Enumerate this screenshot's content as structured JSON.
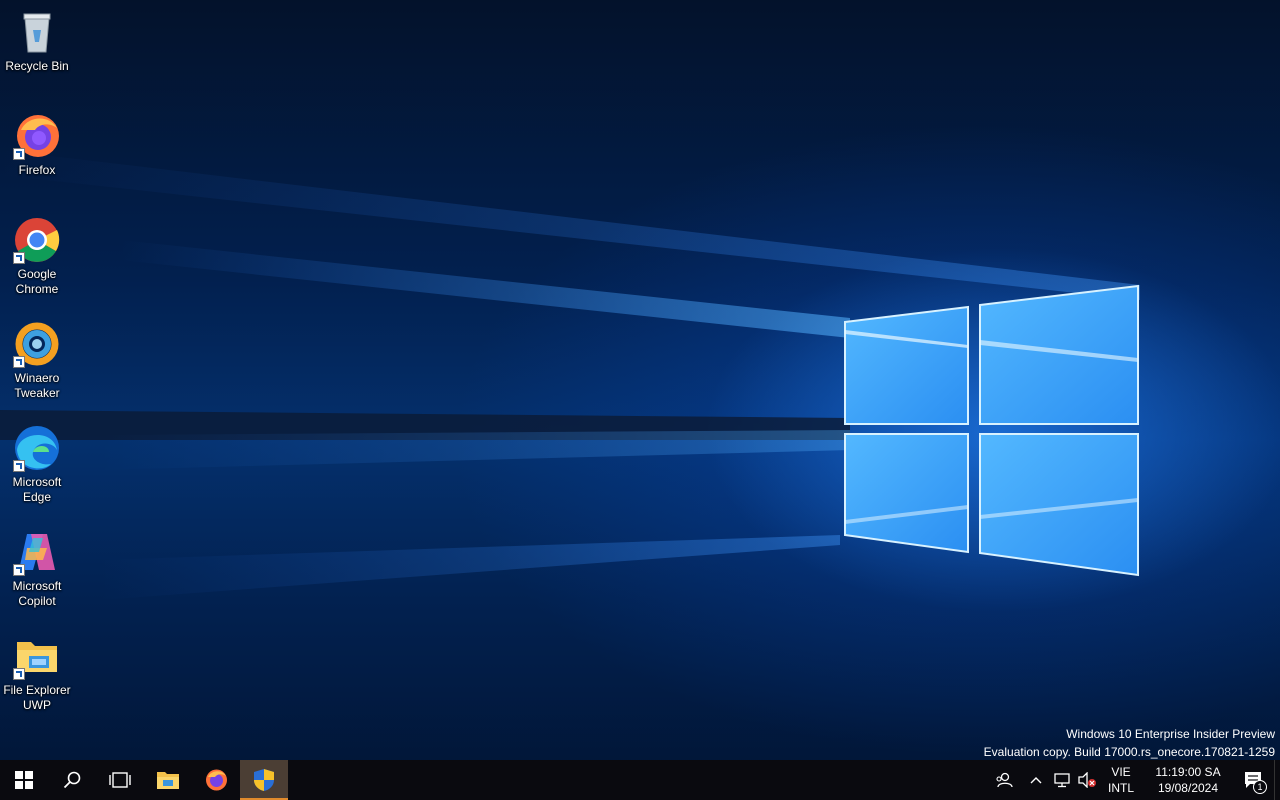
{
  "desktop_icons": [
    {
      "label": "Recycle Bin"
    },
    {
      "label": "Firefox"
    },
    {
      "label": "Google\nChrome"
    },
    {
      "label": "Winaero\nTweaker"
    },
    {
      "label": "Microsoft\nEdge"
    },
    {
      "label": "Microsoft\nCopilot"
    },
    {
      "label": "File Explorer\nUWP"
    }
  ],
  "watermark": {
    "line1": "Windows 10 Enterprise Insider Preview",
    "line2": "Evaluation copy. Build 17000.rs_onecore.170821-1259"
  },
  "taskbar": {
    "start_icon": "windows-logo-icon",
    "search_icon": "search-icon",
    "taskview_icon": "task-view-icon",
    "pinned": [
      "file-explorer-icon",
      "firefox-icon",
      "security-shield-icon"
    ],
    "active_index": 2
  },
  "tray": {
    "lang_line1": "VIE",
    "lang_line2": "INTL",
    "time": "11:19:00 SA",
    "date": "19/08/2024",
    "notification_count": "1"
  },
  "colors": {
    "taskbar_bg": "#0a0a0f",
    "active_accent": "#e08a2c",
    "wallpaper_glow": "#3ba0ff"
  }
}
